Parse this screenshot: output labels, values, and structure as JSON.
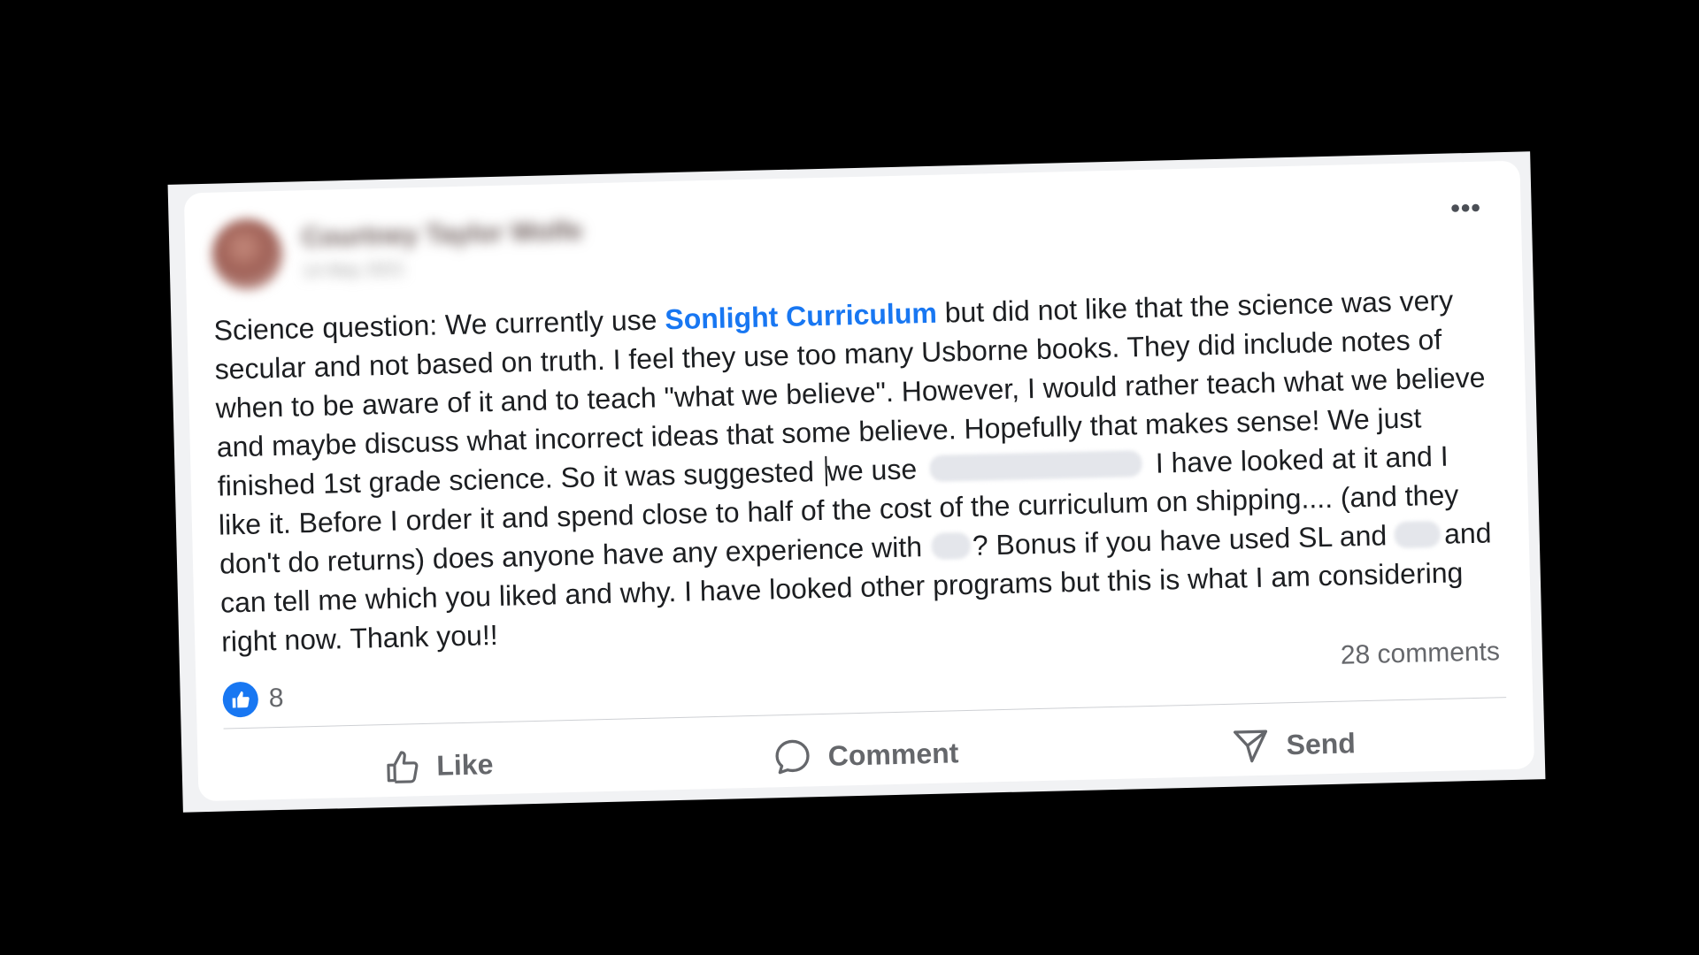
{
  "post": {
    "author_name": "Courtney Taylor Wolfe",
    "timestamp": "14 May 2021",
    "more_icon": "more-horizontal-icon",
    "text": {
      "intro": "Science question: We currently use ",
      "link": "Sonlight Curriculum",
      "part1": " but did not like that the science was very secular and not based on truth. I feel they use too many Usborne books. They did include notes of when to be aware of it and to teach \"what we believe\". However, I would rather teach what we believe and maybe discuss what incorrect ideas that some believe. Hopefully that makes sense! We just finished 1st grade science. So it was suggested ",
      "part2": "we use ",
      "part3": " I have looked at it and I like it. Before I order it and spend close to half of the cost of the curriculum on shipping.... (and they don't do returns) does anyone have any experience with ",
      "part4": "? Bonus if you have used SL and ",
      "part5": "and can tell me which you liked and why. I have looked other programs but this is what I am considering right now. Thank you!!"
    },
    "reactions": {
      "icon": "thumbs-up-icon",
      "count": "8"
    },
    "comments_label": "28 comments",
    "actions": {
      "like_label": "Like",
      "comment_label": "Comment",
      "send_label": "Send"
    }
  },
  "colors": {
    "link": "#1877f2",
    "text": "#1c1e21",
    "muted": "#65676b"
  }
}
